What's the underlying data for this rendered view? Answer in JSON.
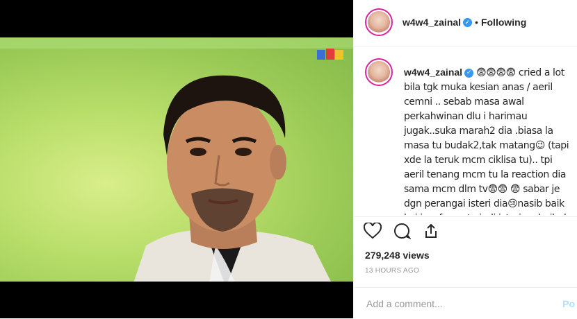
{
  "header": {
    "username": "w4w4_zainal",
    "separator": "•",
    "follow_state": "Following"
  },
  "caption": {
    "username": "w4w4_zainal",
    "text": " 😨😨😨😨 cried a lot bila tgk muka kesian anas / aeril cemni .. sebab masa awal perkahwinan dlu i harimau jugak..suka marah2 dia .biasa la masa tu budak2,tak matang😉 (tapi xde la teruk mcm ciklisa tu).. tpi aeril tenang mcm tu la reaction dia sama mcm dlm tv😨😨 😨 sabar je dgn perangai isteri dia😢nasib baik la i insaf cepat.. jadi isteri yg baik da❤️ .. korang tanya ada ke lelaki sebaik anas ? yg tak melukai hati isteri nya..ada"
  },
  "stats": {
    "views": "279,248 views",
    "timestamp": "13 HOURS AGO"
  },
  "comment": {
    "placeholder": "Add a comment...",
    "post_label": "Po"
  },
  "icons": {
    "like": "heart-icon",
    "comment": "comment-icon",
    "share": "share-icon",
    "verified": "verified-badge-icon"
  },
  "colors": {
    "verified": "#3897f0",
    "text": "#262626",
    "muted": "#999999",
    "post_button": "#b2dffc"
  }
}
